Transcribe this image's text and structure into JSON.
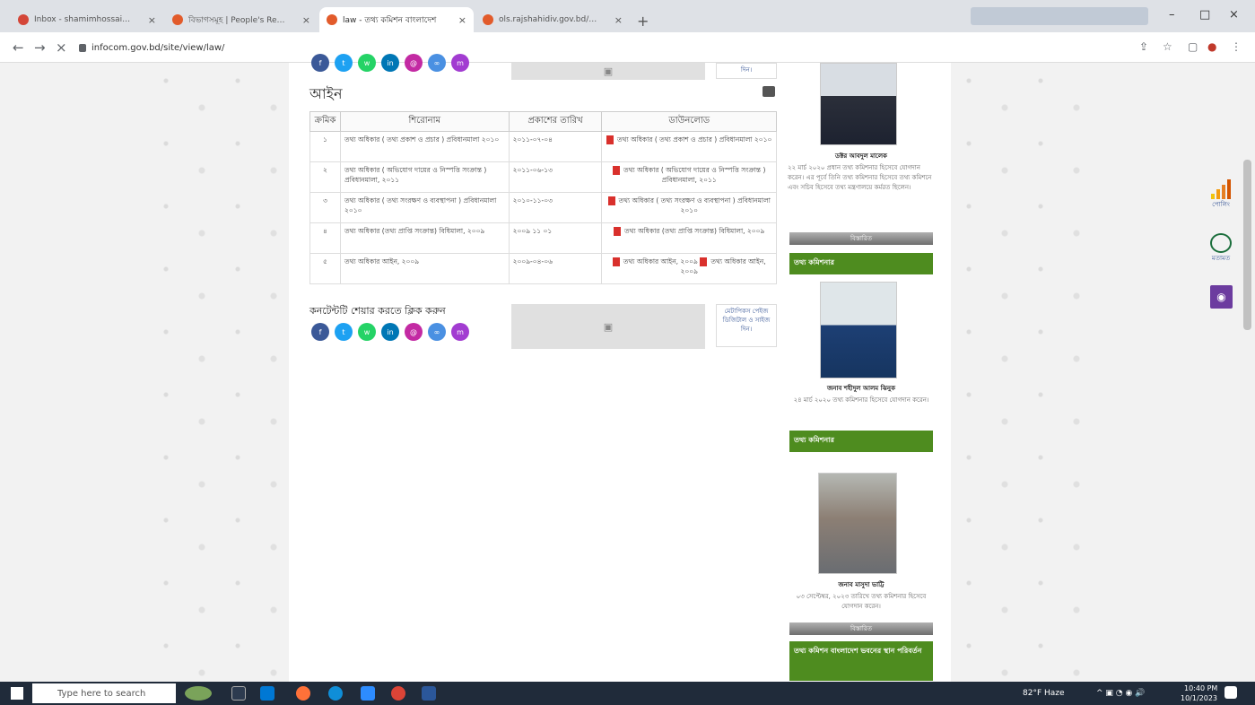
{
  "browser": {
    "tabs": [
      {
        "title": "Inbox - shamimhossainms@gm",
        "color": "#d44638"
      },
      {
        "title": "বিভাগসমূহ | People's Republic o",
        "color": "#e25b2b"
      },
      {
        "title": "law - তথ্য কমিশন বাংলাদেশ",
        "color": "#e25b2b"
      },
      {
        "title": "ols.rajshahidiv.gov.bd/bn/site/",
        "color": "#e25b2b"
      }
    ],
    "new_tab": "+",
    "url": "infocom.gov.bd/site/view/law/"
  },
  "page": {
    "heading": "আইন",
    "table": {
      "headers": [
        "ক্রমিক",
        "শিরোনাম",
        "প্রকাশের তারিখ",
        "ডাউনলোড"
      ],
      "rows": [
        {
          "sl": "১",
          "title": "তথ্য অধিকার ( তথ্য প্রকাশ ও প্রচার ) প্রবিধানমালা ২০১০",
          "date": "২০১১-০৭-০৪",
          "download": "তথ্য অধিকার ( তথ্য প্রকাশ ও প্রচার ) প্রবিধানমালা ২০১০"
        },
        {
          "sl": "২",
          "title": "তথ্য অধিকার ( অভিযোগ দায়ের ও নিস্পত্তি সংক্রান্ত ) প্রবিধানমালা, ২০১১",
          "date": "২০১১-০৬-১৩",
          "download": "তথ্য অধিকার ( অভিযোগ দায়ের ও নিস্পত্তি সংক্রান্ত ) প্রবিধানমালা, ২০১১"
        },
        {
          "sl": "৩",
          "title": "তথ্য অধিকার ( তথ্য সংরক্ষণ ও ব্যবস্থাপনা ) প্রবিধানমালা ২০১০",
          "date": "২০১০-১১-০৩",
          "download": "তথ্য অধিকার ( তথ্য সংরক্ষণ ও ব্যবস্থাপনা ) প্রবিধানমালা ২০১০"
        },
        {
          "sl": "৪",
          "title": "তথ্য অধিকার (তথ্য প্রাপ্তি সংক্রান্ত) বিধিমালা, ২০০৯",
          "date": "২০০৯ ১১ ০১",
          "download": "তথ্য অধিকার (তথ্য প্রাপ্তি সংক্রান্ত) বিধিমালা, ২০০৯"
        },
        {
          "sl": "৫",
          "title": "তথ্য অধিকার আইন, ২০০৯",
          "date": "২০০৯-০৪-০৬",
          "download": "তথ্য অধিকার আইন, ২০০৯",
          "download2": "তথ্য অধিকার আইন, ২০০৯"
        }
      ]
    },
    "share_title": "কনটেন্টটি শেয়ার করতে ক্লিক করুন",
    "share_link": "মেটাপিকস পেইজ ডিজিটাল ও সাইজ দিন।",
    "share_link_top": "দিন।"
  },
  "sidebar": {
    "person1": {
      "name": "ডক্টর আবদুল মালেক",
      "desc": "২২ মার্চ ২০২০ প্রধান তথ্য কমিশনার হিসেবে যোগদান করেন। এর পূর্বে তিনি তথ্য কমিশনার হিসেবে তথ্য কমিশনে এবং সচিব হিসেবে তথ্য মন্ত্রণালয়ে কর্মরত ছিলেন।"
    },
    "bar1": "বিস্তারিত",
    "section1": "তথ্য কমিশনার",
    "person2": {
      "name": "জনাব শহীদুল আলম ঝিনুক",
      "desc": "২৪ মার্চ ২০২০ তথ্য কমিশনার হিসেবে যোগদান করেন।"
    },
    "section2": "তথ্য কমিশনার",
    "person3": {
      "name": "জনাব মাসুদা ভাট্টি",
      "desc": "০৩ সেপ্টেম্বর, ২০২৩ তারিখে তথ্য কমিশনার হিসেবে যোগদান করেন।"
    },
    "bar2": "বিস্তারিত",
    "section3": "তথ্য কমিশন বাংলাদেশ ভবনের স্থান পরিবর্তন"
  },
  "floating": {
    "poll": "পোলিং",
    "comment": "মতামত"
  },
  "taskbar": {
    "search": "Type here to search",
    "weather": "82°F Haze",
    "time": "10:40 PM",
    "date": "10/1/2023"
  },
  "colors": {
    "green": "#4e8c1f",
    "facebook": "#3b5998",
    "twitter": "#1da1f2",
    "whatsapp": "#25d366",
    "linkedin": "#0077b5",
    "purple": "#c32aa3",
    "pdf": "#d9302c"
  }
}
